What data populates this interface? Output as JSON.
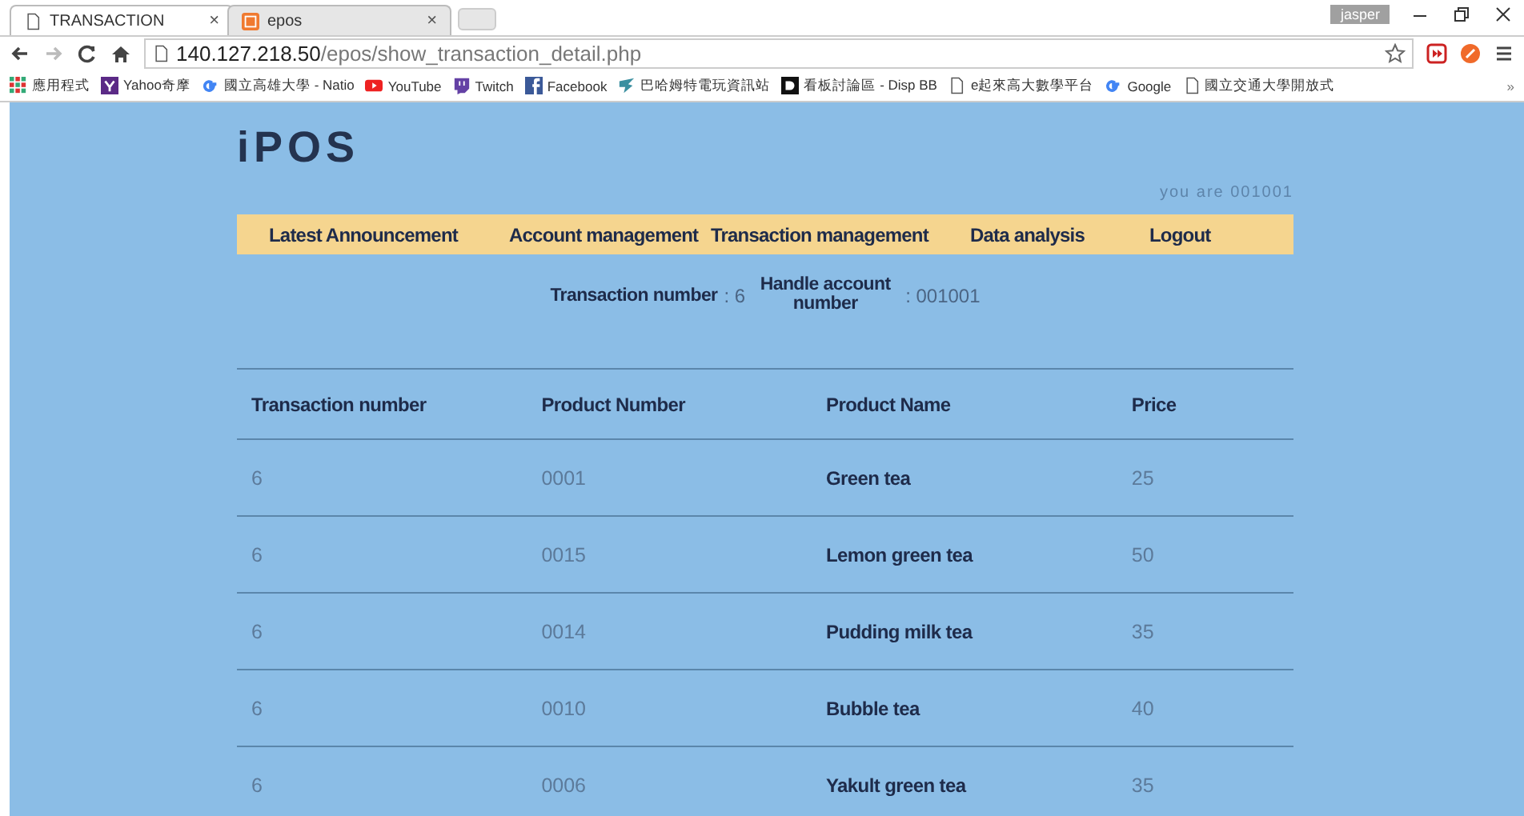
{
  "browser": {
    "tabs": [
      {
        "title": "TRANSACTION",
        "selected": true,
        "kind": "page",
        "close": "×"
      },
      {
        "title": "epos",
        "selected": false,
        "kind": "app",
        "close": "×"
      }
    ],
    "profile": "jasper",
    "address": {
      "host": "140.127.218.50",
      "path": "/epos/show_transaction_detail.php"
    },
    "bookmarks": [
      {
        "label": "應用程式",
        "kind": "apps"
      },
      {
        "label": "Yahoo奇摩",
        "kind": "yahoo"
      },
      {
        "label": "國立高雄大學 - Natio",
        "kind": "g"
      },
      {
        "label": "YouTube",
        "kind": "youtube"
      },
      {
        "label": "Twitch",
        "kind": "twitch"
      },
      {
        "label": "Facebook",
        "kind": "facebook"
      },
      {
        "label": "巴哈姆特電玩資訊站",
        "kind": "dragon"
      },
      {
        "label": "看板討論區 - Disp BB",
        "kind": "d"
      },
      {
        "label": "e起來高大數學平台",
        "kind": "page"
      },
      {
        "label": "Google",
        "kind": "g"
      },
      {
        "label": "國立交通大學開放式",
        "kind": "page"
      }
    ],
    "more": "»"
  },
  "site": {
    "logo": "iPOS",
    "user": "you are 001001",
    "nav": [
      "Latest Announcement",
      "Account management",
      "Transaction management",
      "Data analysis",
      "Logout"
    ]
  },
  "summary": {
    "transaction_label": "Transaction number",
    "transaction_value": ": 6",
    "account_label": "Handle account number",
    "account_value": ": 001001"
  },
  "table": {
    "columns": [
      "Transaction number",
      "Product Number",
      "Product Name",
      "Price"
    ],
    "rows": [
      [
        "6",
        "0001",
        "Green tea",
        "25"
      ],
      [
        "6",
        "0015",
        "Lemon green tea",
        "50"
      ],
      [
        "6",
        "0014",
        "Pudding milk tea",
        "35"
      ],
      [
        "6",
        "0010",
        "Bubble tea",
        "40"
      ],
      [
        "6",
        "0006",
        "Yakult green tea",
        "35"
      ]
    ]
  }
}
